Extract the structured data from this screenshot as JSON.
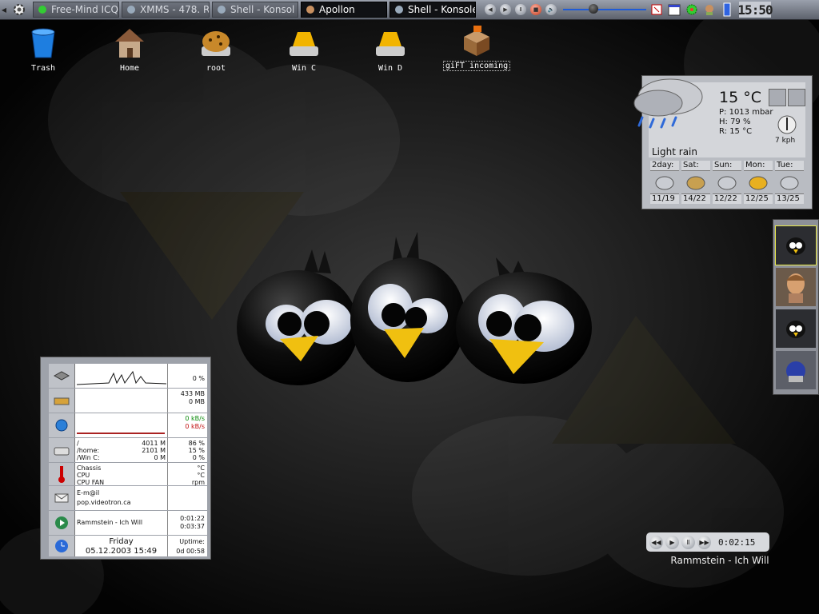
{
  "colors": {
    "taskbar": "#7a7f89",
    "active_task": "#101114",
    "volume_track": "#1e5bd8",
    "weather_panel": "#b9bcc2",
    "sysmon_panel": "#9ea2aa"
  },
  "taskbar": {
    "kmenu_icon": "kde-gear-icon",
    "tasks": [
      {
        "label": "Free-Mind ICQ",
        "icon": "flower-icon",
        "active": false
      },
      {
        "label": "XMMS - 478. R",
        "icon": "headphones-icon",
        "active": false
      },
      {
        "label": "Shell - Konsol",
        "icon": "star-icon",
        "active": false
      },
      {
        "label": "Apollon",
        "icon": "apollon-icon",
        "active": true
      },
      {
        "label": "Shell - Konsole",
        "icon": "star-icon",
        "active": true
      }
    ],
    "media_buttons": [
      "prev",
      "next",
      "pause",
      "stop"
    ],
    "volume_level": 0.35,
    "clock": "15:50"
  },
  "desktop_icons": [
    {
      "label": "Trash",
      "icon": "trash-icon"
    },
    {
      "label": "Home",
      "icon": "home-icon"
    },
    {
      "label": "root",
      "icon": "hard-drive-icon"
    },
    {
      "label": "Win C",
      "icon": "drive-icon"
    },
    {
      "label": "Win D",
      "icon": "drive-icon"
    },
    {
      "label": "giFT incoming",
      "icon": "package-icon",
      "selected": true
    }
  ],
  "weather": {
    "temperature": "15 °C",
    "pressure": "P: 1013 mbar",
    "humidity": "H: 79 %",
    "real_feel": "R: 15 °C",
    "wind": "7 kph",
    "condition": "Light rain",
    "forecast": [
      {
        "day": "2day:",
        "temps": "11/19",
        "icon": "cloud-icon"
      },
      {
        "day": "Sat:",
        "temps": "14/22",
        "icon": "sun-cloud-icon"
      },
      {
        "day": "Sun:",
        "temps": "12/22",
        "icon": "cloud-icon"
      },
      {
        "day": "Mon:",
        "temps": "12/25",
        "icon": "sun-icon"
      },
      {
        "day": "Tue:",
        "temps": "13/25",
        "icon": "cloud-icon"
      }
    ]
  },
  "sysmon": {
    "cpu": "0 %",
    "mem_used": "433 MB",
    "swap_used": "0 MB",
    "net_in": "0 kB/s",
    "net_out": "0 kB/s",
    "disks": [
      {
        "name": "/",
        "size": "4011 M",
        "pct": "86 %"
      },
      {
        "name": "/home:",
        "size": "2101 M",
        "pct": "15 %"
      },
      {
        "name": "/Win C:",
        "size": "0 M",
        "pct": "0 %"
      }
    ],
    "sensors": [
      "Chassis",
      "CPU",
      "CPU FAN"
    ],
    "sensor_units": [
      "°C",
      "°C",
      "rpm"
    ],
    "email_label": "E-m@il",
    "email_server": "pop.videotron.ca",
    "track": "Rammstein - Ich Will",
    "track_elapsed": "0:01:22",
    "track_total": "0:03:37",
    "day": "Friday",
    "datetime": "05.12.2003 15:49",
    "uptime_label": "Uptime:",
    "uptime": "0d 00:58"
  },
  "player": {
    "time": "0:02:15",
    "song": "Rammstein - Ich Will"
  }
}
